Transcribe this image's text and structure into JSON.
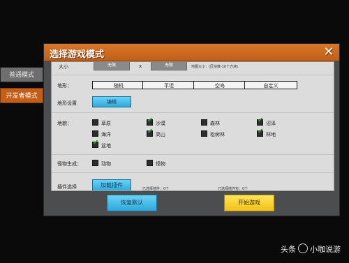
{
  "side_tabs": {
    "normal": "普通模式",
    "developer": "开发者模式"
  },
  "dialog": {
    "title": "选择游戏模式",
    "close_glyph": "✕"
  },
  "size_row": {
    "label": "大小",
    "button1": "无限",
    "x_sep": "x",
    "button2": "无限",
    "note": "地图大小：(区块数-10个方块)"
  },
  "terrain": {
    "label": "地形：",
    "options": [
      "随机",
      "平坦",
      "空岛",
      "自定义"
    ],
    "settings_label": "地形设置",
    "edit_button": "编辑"
  },
  "biomes": {
    "label": "地貌：",
    "items": [
      {
        "name": "草原",
        "checked": false
      },
      {
        "name": "沙漠",
        "checked": true
      },
      {
        "name": "森林",
        "checked": false
      },
      {
        "name": "沼泽",
        "checked": true
      },
      {
        "name": "海洋",
        "checked": false
      },
      {
        "name": "高山",
        "checked": true
      },
      {
        "name": "松树林",
        "checked": false
      },
      {
        "name": "林地",
        "checked": true
      },
      {
        "name": "盆地",
        "checked": true
      }
    ]
  },
  "spawn": {
    "label": "怪物生成：",
    "items": [
      {
        "name": "动物",
        "checked": false
      },
      {
        "name": "怪物",
        "checked": false
      }
    ]
  },
  "plugins": {
    "label": "插件选择",
    "load_button": "加载插件",
    "note1": "已选择插件：0个",
    "note2": "已选择插件包：0个"
  },
  "footer": {
    "restore_button": "恢复默认",
    "start_button": "开始游戏"
  },
  "watermark": {
    "left": "头条",
    "right": "小咖说游"
  },
  "colors": {
    "header_orange": "#cf6a20",
    "accent_blue": "#3fb7e6",
    "start_yellow": "#f7d23a",
    "check_green": "#2e9a2e"
  }
}
